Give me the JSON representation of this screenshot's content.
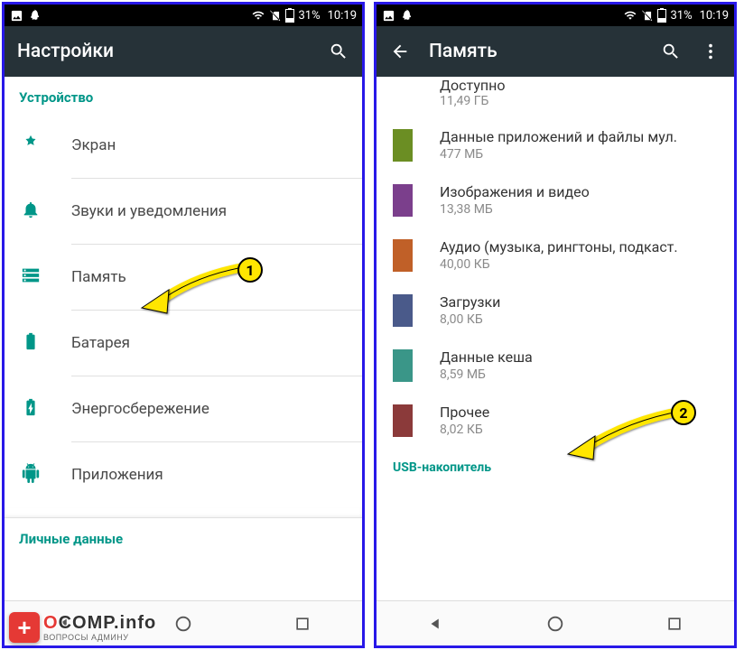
{
  "statusbar": {
    "battery": "31%",
    "time": "10:19"
  },
  "phone1": {
    "title": "Настройки",
    "section1": "Устройство",
    "items": [
      {
        "label": "Экран"
      },
      {
        "label": "Звуки и уведомления"
      },
      {
        "label": "Память"
      },
      {
        "label": "Батарея"
      },
      {
        "label": "Энергосбережение"
      },
      {
        "label": "Приложения"
      }
    ],
    "section2": "Личные данные"
  },
  "phone2": {
    "title": "Память",
    "top": {
      "label": "Доступно",
      "value": "11,49 ГБ"
    },
    "rows": [
      {
        "color": "#6b8e23",
        "label": "Данные приложений и файлы мул.",
        "value": "477 МБ"
      },
      {
        "color": "#7b3f8c",
        "label": "Изображения и видео",
        "value": "13,38 МБ"
      },
      {
        "color": "#c06028",
        "label": "Аудио (музыка, рингтоны, подкаст.",
        "value": "40,00 КБ"
      },
      {
        "color": "#4a5a8a",
        "label": "Загрузки",
        "value": "8,00 КБ"
      },
      {
        "color": "#3a9688",
        "label": "Данные кеша",
        "value": "8,59 МБ"
      },
      {
        "color": "#8b3a3a",
        "label": "Прочее",
        "value": "8,02 КБ"
      }
    ],
    "usb": "USB-накопитель"
  },
  "annotations": {
    "badge1": "1",
    "badge2": "2"
  },
  "watermark": {
    "brand_o": "O",
    "brand_rest": "COMP.info",
    "sub": "ВОПРОСЫ АДМИНУ"
  }
}
